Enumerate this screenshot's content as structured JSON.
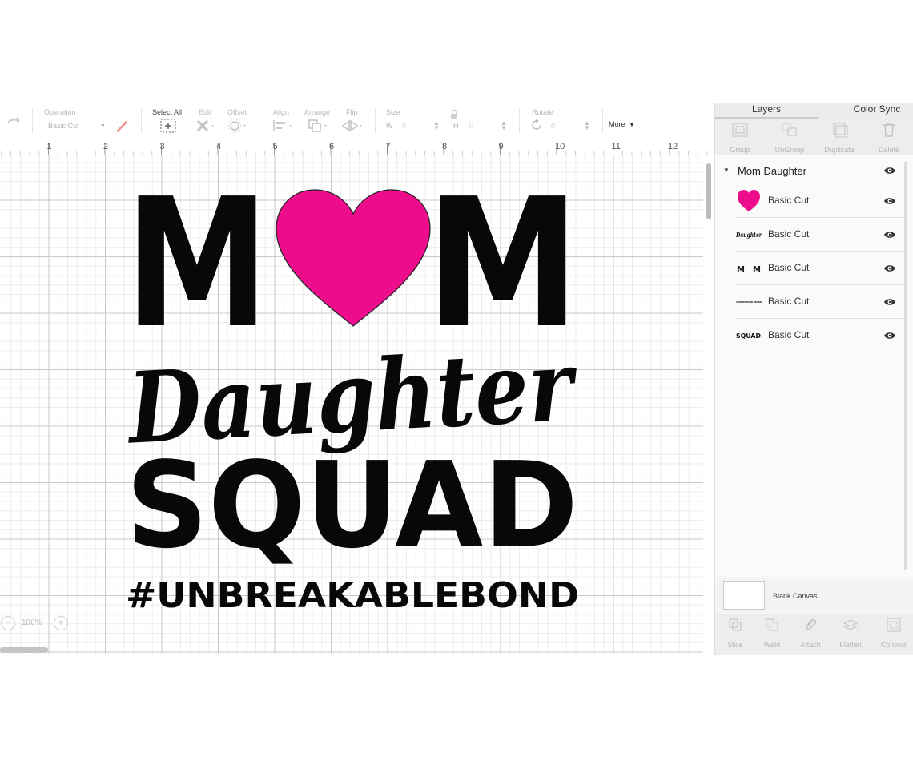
{
  "toolbar": {
    "operation_label": "Operation",
    "operation_value": "Basic Cut",
    "select_all_label": "Select All",
    "edit_label": "Edit",
    "offset_label": "Offset",
    "align_label": "Align",
    "arrange_label": "Arrange",
    "flip_label": "Flip",
    "size_label": "Size",
    "width_prefix": "W",
    "width_value": "0",
    "height_prefix": "H",
    "height_value": "0",
    "rotate_label": "Rotate",
    "rotate_value": "0",
    "more_label": "More"
  },
  "ruler": {
    "numbers": [
      "1",
      "2",
      "3",
      "4",
      "5",
      "6",
      "7",
      "8",
      "9",
      "10",
      "11",
      "12"
    ]
  },
  "canvas": {
    "zoom_level": "100%",
    "design": {
      "line1_left": "M",
      "line1_right": "M",
      "line2": "Daughter",
      "line3": "SQUAD",
      "line4": "#UNBREAKABLEBOND",
      "heart_color": "#ED0C8C",
      "text_color": "#080808"
    }
  },
  "panel": {
    "tabs": [
      "Layers",
      "Color Sync"
    ],
    "actions": [
      "Group",
      "UnGroup",
      "Duplicate",
      "Delete"
    ],
    "group_name": "Mom Daughter",
    "layers": [
      {
        "thumb": "heart",
        "label": "Basic Cut"
      },
      {
        "thumb": "Daughter",
        "label": "Basic Cut"
      },
      {
        "thumb": "M M",
        "label": "Basic Cut"
      },
      {
        "thumb": "#UNBREAKABLEBOND",
        "label": "Basic Cut"
      },
      {
        "thumb": "SQUAD",
        "label": "Basic Cut"
      }
    ],
    "blank_canvas_label": "Blank Canvas",
    "bottom_actions": [
      "Slice",
      "Weld",
      "Attach",
      "Flatten",
      "Contour"
    ]
  },
  "colors": {
    "accent_pink": "#ED0C8C",
    "toolbar_disabled": "#b8b8b8",
    "panel_bg": "#f4f4f4"
  },
  "icons": [
    "redo-icon",
    "pen-color-icon",
    "select-all-icon",
    "edit-icon",
    "offset-icon",
    "align-icon",
    "arrange-icon",
    "flip-icon",
    "lock-icon",
    "rotate-icon",
    "group-icon",
    "ungroup-icon",
    "duplicate-icon",
    "delete-icon",
    "eye-icon",
    "slice-icon",
    "weld-icon",
    "attach-icon",
    "flatten-icon",
    "contour-icon"
  ]
}
